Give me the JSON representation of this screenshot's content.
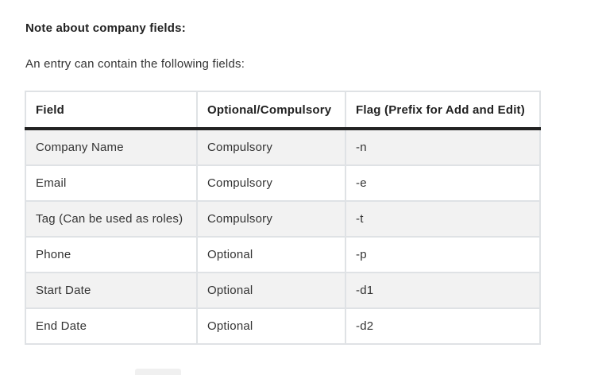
{
  "note": {
    "heading": "Note about company fields:",
    "intro": "An entry can contain the following fields:"
  },
  "table": {
    "headers": [
      "Field",
      "Optional/Compulsory",
      "Flag (Prefix for Add and Edit)"
    ],
    "rows": [
      [
        "Company Name",
        "Compulsory",
        "-n"
      ],
      [
        "Email",
        "Compulsory",
        "-e"
      ],
      [
        "Tag (Can be used as roles)",
        "Compulsory",
        "-t"
      ],
      [
        "Phone",
        "Optional",
        "-p"
      ],
      [
        "Start Date",
        "Optional",
        "-d1"
      ],
      [
        "End Date",
        "Optional",
        "-d2"
      ]
    ]
  }
}
